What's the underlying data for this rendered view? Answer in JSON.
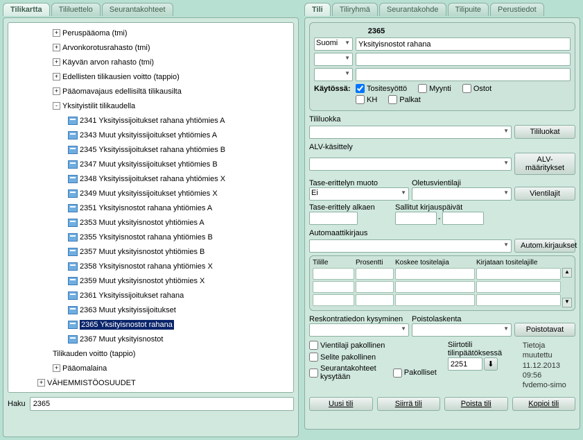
{
  "leftTabs": [
    "Tilikartta",
    "Tililuettelo",
    "Seurantakohteet"
  ],
  "leftActiveTab": 0,
  "rightTabs": [
    "Tili",
    "Tiliryhmä",
    "Seurantakohde",
    "Tilipuite",
    "Perustiedot"
  ],
  "rightActiveTab": 0,
  "tree": [
    {
      "level": 1,
      "toggle": "+",
      "label": "Peruspääoma (tmi)"
    },
    {
      "level": 1,
      "toggle": "+",
      "label": "Arvonkorotusrahasto (tmi)"
    },
    {
      "level": 1,
      "toggle": "+",
      "label": "Käyvän arvon rahasto (tmi)"
    },
    {
      "level": 1,
      "toggle": "+",
      "label": "Edellisten tilikausien voitto (tappio)"
    },
    {
      "level": 1,
      "toggle": "+",
      "label": "Pääomavajaus edellisiltä tilikausilta"
    },
    {
      "level": 1,
      "toggle": "-",
      "label": "Yksityistilit tilikaudella"
    },
    {
      "level": 2,
      "icon": true,
      "label": "2341 Yksityissijoitukset rahana yhtiömies A"
    },
    {
      "level": 2,
      "icon": true,
      "label": "2343 Muut yksityissijoitukset yhtiömies A"
    },
    {
      "level": 2,
      "icon": true,
      "label": "2345 Yksityissijoitukset rahana yhtiömies B"
    },
    {
      "level": 2,
      "icon": true,
      "label": "2347 Muut yksityissijoitukset  yhtiömies B"
    },
    {
      "level": 2,
      "icon": true,
      "label": "2348 Yksityissijoitukset rahana yhtiömies X"
    },
    {
      "level": 2,
      "icon": true,
      "label": "2349 Muut yksityissijoitukset yhtiömies X"
    },
    {
      "level": 2,
      "icon": true,
      "label": "2351 Yksityisnostot rahana yhtiömies A"
    },
    {
      "level": 2,
      "icon": true,
      "label": "2353 Muut yksityisnostot yhtiömies A"
    },
    {
      "level": 2,
      "icon": true,
      "label": "2355 Yksityisnostot rahana yhtiömies B"
    },
    {
      "level": 2,
      "icon": true,
      "label": "2357 Muut yksityisnostot  yhtiömies B"
    },
    {
      "level": 2,
      "icon": true,
      "label": "2358 Yksityisnostot rahana yhtiömies X"
    },
    {
      "level": 2,
      "icon": true,
      "label": "2359 Muut yksityisnostot yhtiömies X"
    },
    {
      "level": 2,
      "icon": true,
      "label": "2361 Yksityissijoitukset rahana"
    },
    {
      "level": 2,
      "icon": true,
      "label": "2363 Muut yksityissijoitukset"
    },
    {
      "level": 2,
      "icon": true,
      "label": "2365 Yksityisnostot rahana",
      "selected": true
    },
    {
      "level": 2,
      "icon": true,
      "label": "2367 Muut yksityisnostot"
    },
    {
      "level": 1,
      "label": "Tilikauden voitto (tappio)"
    },
    {
      "level": 1,
      "toggle": "+",
      "label": "Pääomalaina"
    },
    {
      "level": 0,
      "toggle": "+",
      "label": "VÄHEMMISTÖOSUUDET"
    }
  ],
  "hakuLabel": "Haku",
  "hakuValue": "2365",
  "account": {
    "number": "2365",
    "lang": "Suomi",
    "name": "Yksityisnostot rahana",
    "kaytossaLabel": "Käytössä:",
    "checks": {
      "tositesyotto": {
        "label": "Tositesyöttö",
        "checked": true
      },
      "myynti": {
        "label": "Myynti",
        "checked": false
      },
      "ostot": {
        "label": "Ostot",
        "checked": false
      },
      "kh": {
        "label": "KH",
        "checked": false
      },
      "palkat": {
        "label": "Palkat",
        "checked": false
      }
    }
  },
  "labels": {
    "tililuokka": "Tililuokka",
    "tililuokatBtn": "Tililuokat",
    "alvKasittely": "ALV-käsittely",
    "alvMaarityksetBtn": "ALV-määritykset",
    "taseErittelynMuoto": "Tase-erittelyn muoto",
    "oletusvientilaji": "Oletusvientilaji",
    "vientilajitBtn": "Vientilajit",
    "taseErittelyAlkaen": "Tase-erittely alkaen",
    "sallitutKirjauspaivat": "Sallitut kirjauspäivät",
    "automaattikirjaus": "Automaattikirjaus",
    "automKirjauksetBtn": "Autom.kirjaukset",
    "gridH1": "Tilille",
    "gridH2": "Prosentti",
    "gridH3": "Koskee tositelajia",
    "gridH4": "Kirjataan tositelajille",
    "reskontratiedon": "Reskontratiedon kysyminen",
    "poistolaskenta": "Poistolaskenta",
    "poistotavatBtn": "Poistotavat",
    "vientilajiPakollinen": "Vientilaji pakollinen",
    "selitePakollinen": "Selite pakollinen",
    "seurantakohteetKysytaan": "Seurantakohteet kysytään",
    "pakolliset": "Pakolliset",
    "siirtotili": "Siirtotili tilinpäätöksessä",
    "siirtotiliVal": "2251",
    "muutettu1": "Tietoja muutettu",
    "muutettu2": "11.12.2013 09:56",
    "muutettu3": "fvdemo-simo",
    "btnUusi": "Uusi tili",
    "btnSiirra": "Siirrä tili",
    "btnPoista": "Poista tili",
    "btnKopioi": "Kopioi tili",
    "taseEiVal": "Ei",
    "dash": "-"
  }
}
